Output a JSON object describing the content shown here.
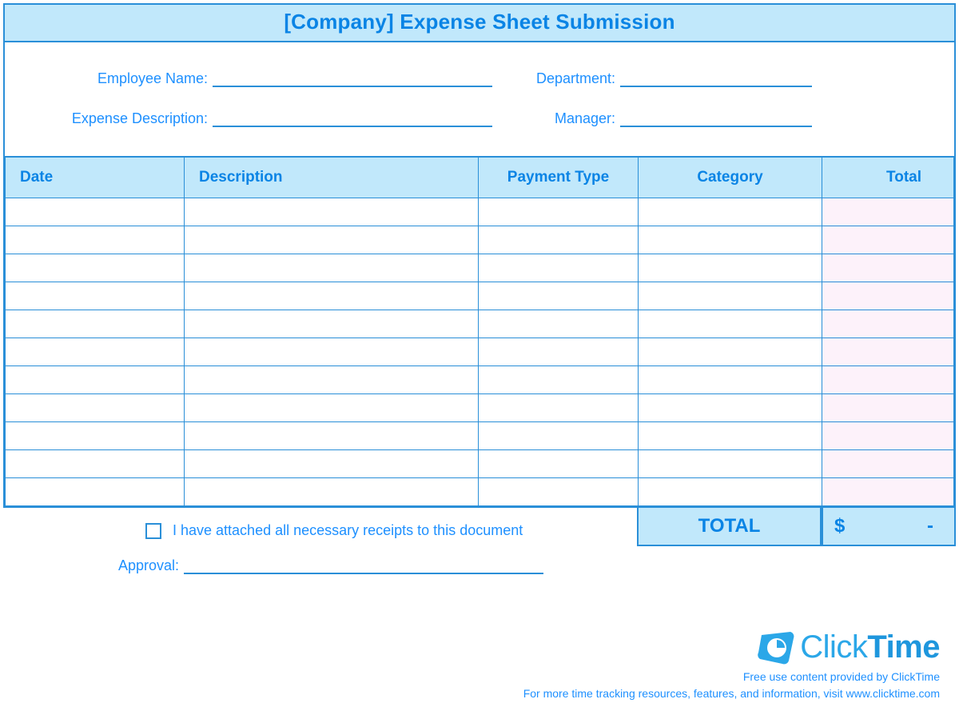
{
  "title": "[Company] Expense Sheet Submission",
  "info": {
    "employee_name_label": "Employee Name:",
    "department_label": "Department:",
    "expense_description_label": "Expense Description:",
    "manager_label": "Manager:",
    "employee_name_value": "",
    "department_value": "",
    "expense_description_value": "",
    "manager_value": ""
  },
  "table": {
    "headers": {
      "date": "Date",
      "description": "Description",
      "payment_type": "Payment Type",
      "category": "Category",
      "total": "Total"
    },
    "rows": [
      {
        "date": "",
        "description": "",
        "payment_type": "",
        "category": "",
        "total": ""
      },
      {
        "date": "",
        "description": "",
        "payment_type": "",
        "category": "",
        "total": ""
      },
      {
        "date": "",
        "description": "",
        "payment_type": "",
        "category": "",
        "total": ""
      },
      {
        "date": "",
        "description": "",
        "payment_type": "",
        "category": "",
        "total": ""
      },
      {
        "date": "",
        "description": "",
        "payment_type": "",
        "category": "",
        "total": ""
      },
      {
        "date": "",
        "description": "",
        "payment_type": "",
        "category": "",
        "total": ""
      },
      {
        "date": "",
        "description": "",
        "payment_type": "",
        "category": "",
        "total": ""
      },
      {
        "date": "",
        "description": "",
        "payment_type": "",
        "category": "",
        "total": ""
      },
      {
        "date": "",
        "description": "",
        "payment_type": "",
        "category": "",
        "total": ""
      },
      {
        "date": "",
        "description": "",
        "payment_type": "",
        "category": "",
        "total": ""
      },
      {
        "date": "",
        "description": "",
        "payment_type": "",
        "category": "",
        "total": ""
      }
    ]
  },
  "grand_total": {
    "label": "TOTAL",
    "currency": "$",
    "value": "-"
  },
  "receipts": {
    "checked": false,
    "text": "I have attached all necessary receipts to this document"
  },
  "approval": {
    "label": "Approval:",
    "value": ""
  },
  "footer": {
    "brand_part1": "Click",
    "brand_part2": "Time",
    "line1": "Free use content provided by ClickTime",
    "line2": "For more time tracking resources, features, and information, visit www.clicktime.com"
  }
}
